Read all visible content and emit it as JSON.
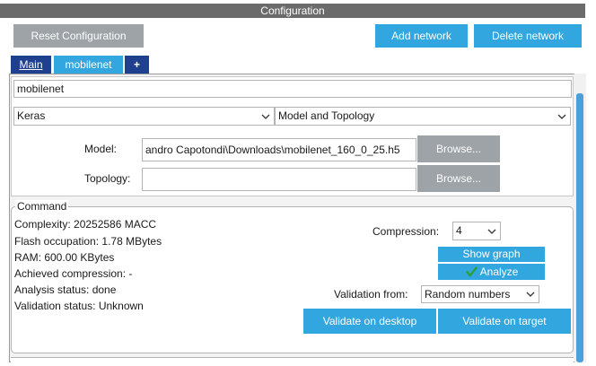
{
  "window": {
    "title": "Configuration"
  },
  "toolbar": {
    "reset_label": "Reset Configuration",
    "add_network_label": "Add network",
    "delete_network_label": "Delete network"
  },
  "tabs": [
    {
      "label": "Main",
      "active": true
    },
    {
      "label": "mobilenet",
      "active": false
    },
    {
      "label": "+",
      "active": false
    }
  ],
  "network": {
    "name_value": "mobilenet",
    "framework": "Keras",
    "model_type": "Model and Topology",
    "model_label": "Model:",
    "model_path": "andro Capotondi\\Downloads\\mobilenet_160_0_25.h5",
    "topology_label": "Topology:",
    "topology_path": "",
    "browse_label": "Browse..."
  },
  "command": {
    "legend": "Command",
    "stats": [
      "Complexity: 20252586 MACC",
      "Flash occupation: 1.78 MBytes",
      "RAM: 600.00 KBytes",
      "Achieved compression: -",
      "Analysis status: done",
      "Validation status: Unknown"
    ],
    "compression_label": "Compression:",
    "compression_value": "4",
    "show_graph_label": "Show graph",
    "analyze_label": "Analyze",
    "validation_from_label": "Validation from:",
    "validation_from_value": "Random numbers",
    "validate_desktop_label": "Validate on desktop",
    "validate_target_label": "Validate on target"
  },
  "colors": {
    "accent_blue": "#32a6df",
    "active_tab": "#1f3f8f",
    "button_gray": "#9ea3a8",
    "titlebar": "#6b6b6b",
    "check_green": "#2e9e3a"
  },
  "icons": {
    "chevron": "chevron-down-icon",
    "analyze": "checkmark-icon"
  }
}
